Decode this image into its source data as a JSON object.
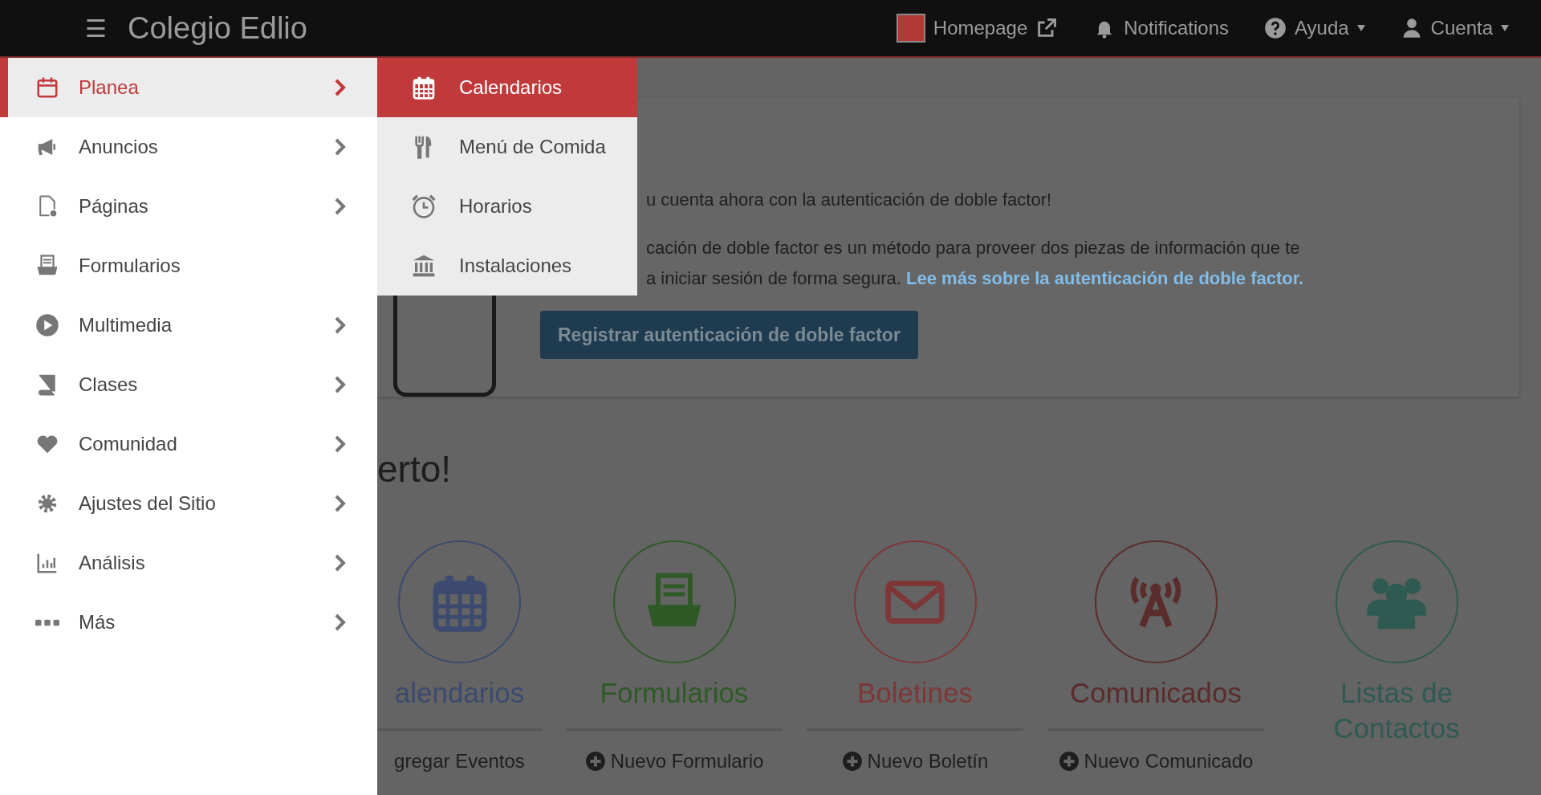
{
  "topbar": {
    "menu_icon": "☰",
    "title": "Colegio Edlio",
    "links": [
      {
        "label": "Homepage",
        "external": true,
        "dropdown": false
      },
      {
        "label": "Notifications",
        "external": false,
        "dropdown": false
      },
      {
        "label": "Ayuda",
        "external": false,
        "dropdown": true
      },
      {
        "label": "Cuenta",
        "external": false,
        "dropdown": true
      }
    ]
  },
  "sidebar": {
    "items": [
      {
        "label": "Planea",
        "selected": true,
        "expandable": true
      },
      {
        "label": "Anuncios",
        "selected": false,
        "expandable": true
      },
      {
        "label": "Páginas",
        "selected": false,
        "expandable": true
      },
      {
        "label": "Formularios",
        "selected": false,
        "expandable": false
      },
      {
        "label": "Multimedia",
        "selected": false,
        "expandable": true
      },
      {
        "label": "Clases",
        "selected": false,
        "expandable": true
      },
      {
        "label": "Comunidad",
        "selected": false,
        "expandable": true
      },
      {
        "label": "Ajustes del Sitio",
        "selected": false,
        "expandable": true
      },
      {
        "label": "Análisis",
        "selected": false,
        "expandable": true
      },
      {
        "label": "Más",
        "selected": false,
        "expandable": true
      }
    ]
  },
  "submenu": {
    "items": [
      {
        "label": "Calendarios",
        "selected": true
      },
      {
        "label": "Menú de Comida",
        "selected": false
      },
      {
        "label": "Horarios",
        "selected": false
      },
      {
        "label": "Instalaciones",
        "selected": false
      }
    ]
  },
  "notice": {
    "line": "u cuenta ahora con la autenticación de doble factor!",
    "paragraph": [
      "cación de doble factor es un método para proveer dos piezas de información que te",
      "a iniciar sesión de forma segura."
    ],
    "link": "Lee más sobre la autenticación de doble factor.",
    "button": "Registrar autenticación de doble factor"
  },
  "heading": "erto!",
  "tiles": [
    {
      "label": "alendarios",
      "action": "gregar Eventos",
      "color": "#3b4a6e"
    },
    {
      "label": "Formularios",
      "action": "Nuevo Formulario",
      "color": "#2f5a27"
    },
    {
      "label": "Boletines",
      "action": "Nuevo Boletín",
      "color": "#7f3636"
    },
    {
      "label": "Comunicados",
      "action": "Nuevo Comunicado",
      "color": "#5a2c2c"
    },
    {
      "label": "Listas de Contactos",
      "color": "#2f5a52"
    }
  ]
}
